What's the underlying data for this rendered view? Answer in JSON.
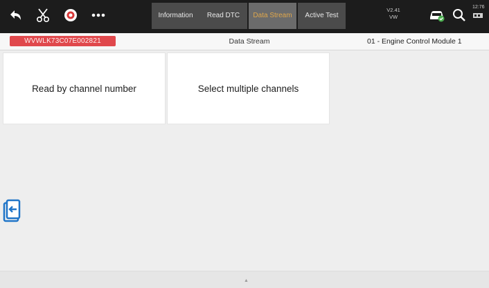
{
  "toolbar": {
    "icons": [
      "back-icon",
      "scissors-icon",
      "record-icon",
      "more-icon",
      "vehicle-check-icon",
      "search-icon"
    ],
    "tabs": [
      {
        "label": "Information"
      },
      {
        "label": "Read DTC"
      },
      {
        "label": "Data Stream",
        "active": true
      },
      {
        "label": "Active Test"
      }
    ],
    "version": "V2.41",
    "make": "VW",
    "clock": "12:76"
  },
  "infobar": {
    "vin": "WVWLK73C07E002821",
    "title": "Data Stream",
    "module": "01 - Engine Control Module 1"
  },
  "main": {
    "options": [
      {
        "label": "Read by channel number"
      },
      {
        "label": "Select multiple channels"
      }
    ]
  },
  "side": {
    "icon": "exit-tab-icon"
  },
  "colors": {
    "toolbar_bg": "#1c1c1c",
    "active_tab_text": "#e0a74b",
    "vin_badge": "#e0484c",
    "side_tab": "#1f74c8"
  }
}
